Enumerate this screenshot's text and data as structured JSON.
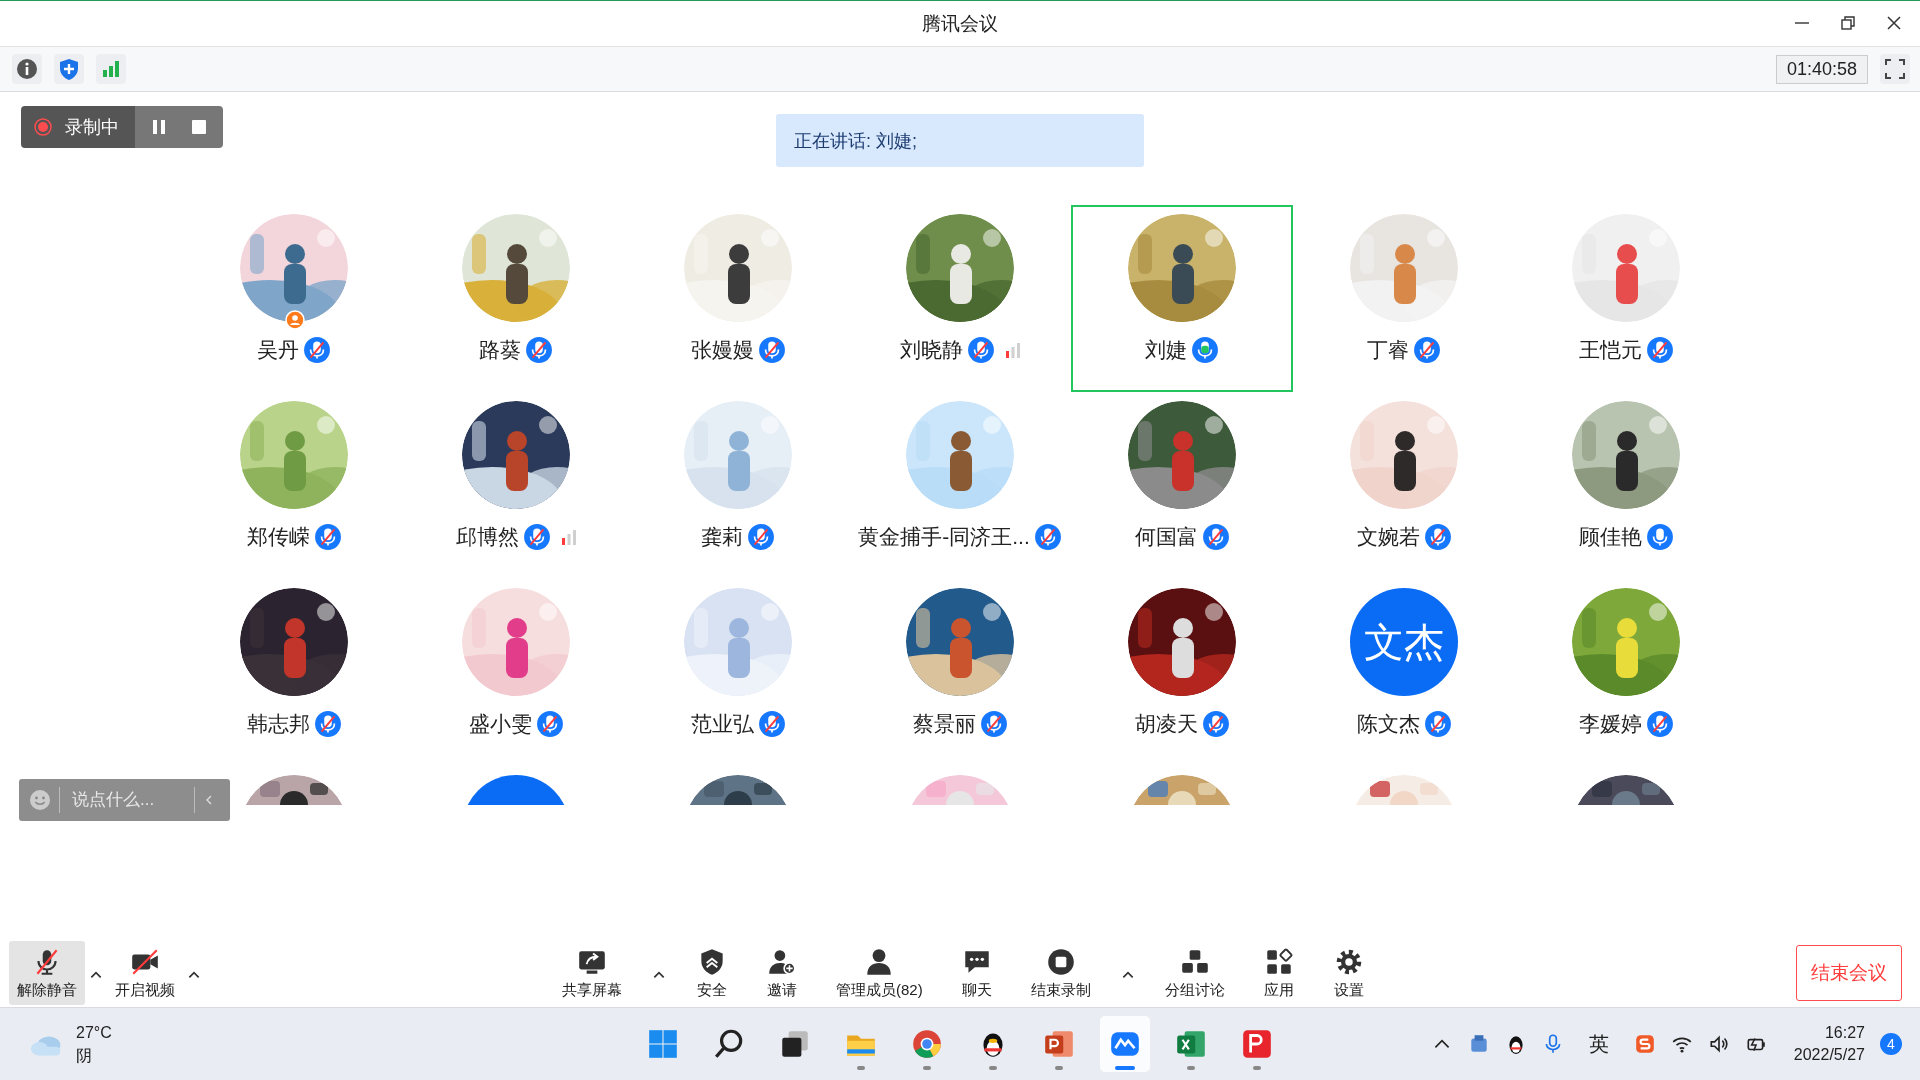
{
  "window": {
    "title": "腾讯会议"
  },
  "toolbar": {
    "timer": "01:40:58"
  },
  "recording": {
    "label": "录制中",
    "paused": false
  },
  "speaking_banner": "正在讲话: 刘婕;",
  "participants": [
    {
      "name": "吴丹",
      "kind": "picture",
      "muted": true,
      "speaking": false,
      "host": true,
      "weak_signal": false
    },
    {
      "name": "路葵",
      "kind": "picture",
      "muted": true,
      "speaking": false,
      "host": false,
      "weak_signal": false
    },
    {
      "name": "张嫚嫚",
      "kind": "picture",
      "muted": true,
      "speaking": false,
      "host": false,
      "weak_signal": false
    },
    {
      "name": "刘晓静",
      "kind": "picture",
      "muted": true,
      "speaking": false,
      "host": false,
      "weak_signal": true
    },
    {
      "name": "刘婕",
      "kind": "picture",
      "muted": false,
      "speaking": true,
      "host": false,
      "weak_signal": false
    },
    {
      "name": "丁睿",
      "kind": "picture",
      "muted": true,
      "speaking": false,
      "host": false,
      "weak_signal": false
    },
    {
      "name": "王恺元",
      "kind": "picture",
      "muted": true,
      "speaking": false,
      "host": false,
      "weak_signal": false
    },
    {
      "name": "郑传嵘",
      "kind": "picture",
      "muted": true,
      "speaking": false,
      "host": false,
      "weak_signal": false
    },
    {
      "name": "邱博然",
      "kind": "picture",
      "muted": true,
      "speaking": false,
      "host": false,
      "weak_signal": true
    },
    {
      "name": "龚莉",
      "kind": "picture",
      "muted": true,
      "speaking": false,
      "host": false,
      "weak_signal": false
    },
    {
      "name": "黄金捕手-同济王...",
      "kind": "picture",
      "muted": true,
      "speaking": false,
      "host": false,
      "weak_signal": false
    },
    {
      "name": "何国富",
      "kind": "picture",
      "muted": true,
      "speaking": false,
      "host": false,
      "weak_signal": false
    },
    {
      "name": "文婉若",
      "kind": "picture",
      "muted": true,
      "speaking": false,
      "host": false,
      "weak_signal": false
    },
    {
      "name": "顾佳艳",
      "kind": "picture",
      "muted": false,
      "speaking": false,
      "host": false,
      "weak_signal": false
    },
    {
      "name": "韩志邦",
      "kind": "picture",
      "muted": true,
      "speaking": false,
      "host": false,
      "weak_signal": false
    },
    {
      "name": "盛小雯",
      "kind": "picture",
      "muted": true,
      "speaking": false,
      "host": false,
      "weak_signal": false
    },
    {
      "name": "范业弘",
      "kind": "picture",
      "muted": true,
      "speaking": false,
      "host": false,
      "weak_signal": false
    },
    {
      "name": "蔡景丽",
      "kind": "picture",
      "muted": true,
      "speaking": false,
      "host": false,
      "weak_signal": false
    },
    {
      "name": "胡凌天",
      "kind": "picture",
      "muted": true,
      "speaking": false,
      "host": false,
      "weak_signal": false
    },
    {
      "name": "陈文杰",
      "kind": "initials",
      "avatar_text": "文杰",
      "muted": true,
      "speaking": false,
      "host": false,
      "weak_signal": false
    },
    {
      "name": "李媛婷",
      "kind": "picture",
      "muted": true,
      "speaking": false,
      "host": false,
      "weak_signal": false
    }
  ],
  "partial_row": [
    {
      "kind": "picture"
    },
    {
      "kind": "plain"
    },
    {
      "kind": "picture"
    },
    {
      "kind": "picture"
    },
    {
      "kind": "picture"
    },
    {
      "kind": "picture"
    },
    {
      "kind": "picture"
    }
  ],
  "chat_input": {
    "placeholder": "说点什么..."
  },
  "meeting_controls_left": [
    {
      "label": "解除静音",
      "kind": "mic",
      "active": true,
      "caret": true
    },
    {
      "label": "开启视频",
      "kind": "camera",
      "active": false,
      "caret": true
    }
  ],
  "meeting_controls": [
    {
      "label": "共享屏幕",
      "kind": "share",
      "caret": true
    },
    {
      "label": "安全",
      "kind": "shield",
      "caret": false
    },
    {
      "label": "邀请",
      "kind": "invite",
      "caret": false
    },
    {
      "label": "管理成员(82)",
      "kind": "members",
      "caret": false
    },
    {
      "label": "聊天",
      "kind": "chat",
      "caret": false
    },
    {
      "label": "结束录制",
      "kind": "stop",
      "caret": true
    },
    {
      "label": "分组讨论",
      "kind": "groups",
      "caret": false
    },
    {
      "label": "应用",
      "kind": "apps",
      "caret": false
    },
    {
      "label": "设置",
      "kind": "settings",
      "caret": false
    }
  ],
  "end_button": "结束会议",
  "taskbar": {
    "weather": {
      "temp": "27°C",
      "condition": "阴"
    },
    "apps": [
      {
        "kind": "start",
        "running": false,
        "selected": false
      },
      {
        "kind": "search",
        "running": false,
        "selected": false
      },
      {
        "kind": "taskview",
        "running": false,
        "selected": false
      },
      {
        "kind": "folder",
        "running": true,
        "selected": false
      },
      {
        "kind": "browser",
        "running": true,
        "selected": false
      },
      {
        "kind": "penguin",
        "running": true,
        "selected": false
      },
      {
        "kind": "slides",
        "running": true,
        "selected": false
      },
      {
        "kind": "meeting",
        "running": true,
        "selected": true
      },
      {
        "kind": "sheet",
        "running": true,
        "selected": false
      },
      {
        "kind": "pdf",
        "running": true,
        "selected": false
      }
    ],
    "ime": "英",
    "time": "16:27",
    "date": "2022/5/27",
    "notifications": "4"
  }
}
